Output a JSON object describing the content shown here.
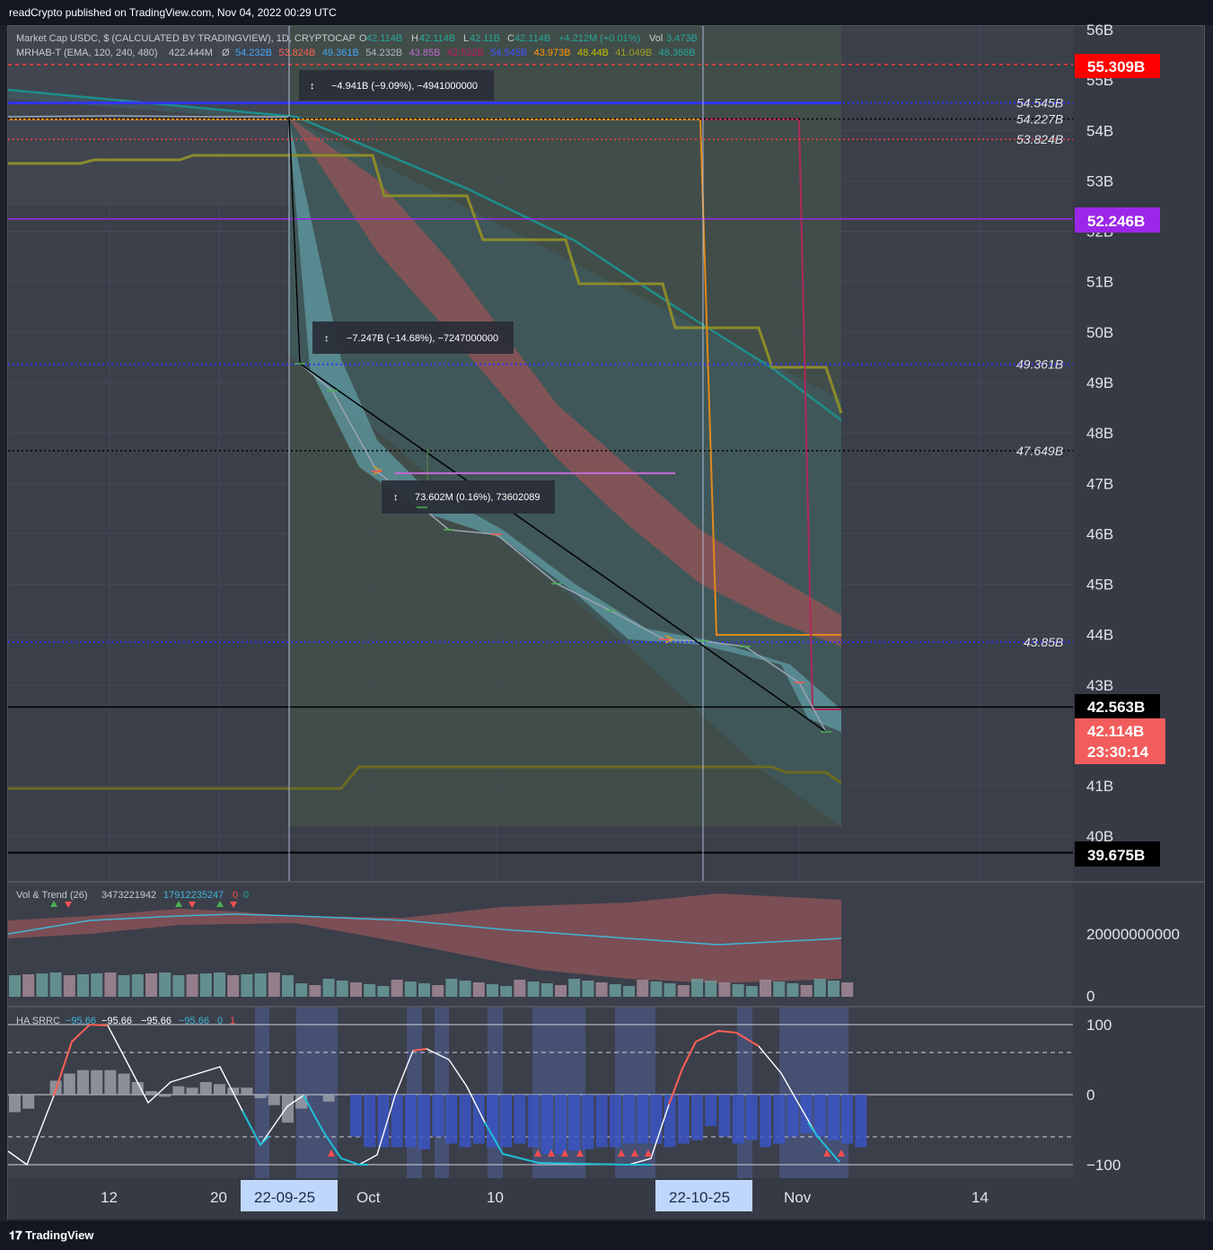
{
  "header": {
    "published": "readCrypto published on TradingView.com, Nov 04, 2022 00:29 UTC"
  },
  "legend": {
    "symbol": "Market Cap USDC, $ (CALCULATED BY TRADINGVIEW), 1D, CRYPTOCAP",
    "o_label": "O",
    "o": "42.114B",
    "h_label": "H",
    "h": "42.114B",
    "l_label": "L",
    "l": "42.11B",
    "c_label": "C",
    "c": "42.114B",
    "change": "+4.212M (+0.01%)",
    "vol_label": "Vol",
    "vol": "3.473B",
    "indicator": "MRHAB-T (EMA, 120, 240, 480)",
    "ind_v1": "422.444M",
    "ind_sym": "Ø",
    "ind_values": [
      "54.232B",
      "53.824B",
      "49.361B",
      "54.232B",
      "43.85B",
      "42.532B",
      "54.545B",
      "43.973B",
      "48.44B",
      "41.049B",
      "48.386B"
    ]
  },
  "price_axis": {
    "ticks": [
      "56B",
      "55B",
      "54B",
      "53B",
      "52B",
      "51B",
      "50B",
      "49B",
      "48B",
      "47B",
      "46B",
      "45B",
      "44B",
      "43B",
      "41B",
      "40B"
    ],
    "labels": {
      "red": "55.309B",
      "purple": "52.246B",
      "black1": "42.563B",
      "current": "42.114B",
      "countdown": "23:30:14",
      "black2": "39.675B"
    },
    "line_labels": [
      "54.545B",
      "54.227B",
      "53.824B",
      "49.361B",
      "47.649B",
      "43.85B"
    ]
  },
  "measures": [
    "−4.941B (−9.09%), −4941000000",
    "−7.247B (−14.68%), −7247000000",
    "73.602M (0.16%), 73602089"
  ],
  "volume_pane": {
    "title": "Vol & Trend (26)",
    "v1": "3473221942",
    "v2": "17912235247",
    "v3": "0",
    "v4": "0",
    "axis": [
      "20000000000",
      "0"
    ]
  },
  "srrc_pane": {
    "title": "HA SRRC",
    "v1": "−95.66",
    "v2": "−95.66",
    "v3": "−95.66",
    "v4": "−95.66",
    "v5": "0",
    "v6": "1",
    "axis": [
      "100",
      "0",
      "−100"
    ]
  },
  "time_axis": {
    "ticks": [
      "12",
      "20",
      "Oct",
      "10",
      "Nov",
      "14"
    ],
    "highlight1": "22-09-25",
    "highlight2": "22-10-25"
  },
  "footer": {
    "brand": "TradingView"
  },
  "chart_data": {
    "type": "line",
    "title": "Market Cap USDC, $ (CALCULATED BY TRADINGVIEW), 1D, CRYPTOCAP",
    "xlabel": "",
    "ylabel": "",
    "ylim": [
      39.6,
      56.1
    ],
    "x": [
      "2022-09-07",
      "2022-09-12",
      "2022-09-20",
      "2022-09-25",
      "2022-09-26",
      "2022-09-28",
      "2022-10-01",
      "2022-10-04",
      "2022-10-06",
      "2022-10-10",
      "2022-10-13",
      "2022-10-16",
      "2022-10-20",
      "2022-10-25",
      "2022-10-28",
      "2022-11-01",
      "2022-11-04"
    ],
    "series": [
      {
        "values": [
          54.2,
          54.3,
          54.3,
          54.3,
          49.4,
          48.6,
          47.3,
          46.6,
          46.1,
          46.0,
          45.0,
          44.5,
          43.9,
          43.9,
          43.8,
          43.2,
          42.1
        ]
      }
    ],
    "horizontal_levels": [
      55.309,
      54.545,
      54.227,
      53.824,
      52.246,
      49.361,
      47.649,
      43.85,
      42.563,
      39.675
    ]
  }
}
